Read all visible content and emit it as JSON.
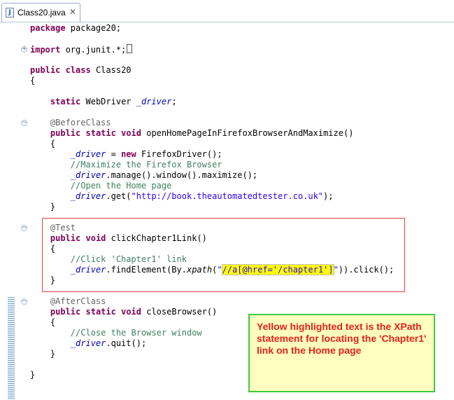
{
  "tab": {
    "title": "Class20.java",
    "close_glyph": "✕",
    "icon": "java-file-icon"
  },
  "code": {
    "package_kw": "package",
    "package_name": " package20;",
    "import_kw": "import",
    "import_rest": " org.junit.*;",
    "class_kw1": "public",
    "class_kw2": "class",
    "class_name": " Class20",
    "brace_open": "{",
    "brace_close": "}",
    "static_kw": "static",
    "webdriver_type": " WebDriver ",
    "driver_field": "_driver",
    "semicolon": ";",
    "before_class": "@BeforeClass",
    "public_kw": "public",
    "static_kw2": "static",
    "void_kw": "void",
    "open_method": " openHomePageInFirefoxBrowserAndMaximize()",
    "new_kw": "new",
    "assign_firefox": " = ",
    "firefox_ctor": " FirefoxDriver();",
    "cmt_maximize": "//Maximize the Firefox Browser",
    "manage_call": ".manage().window().maximize();",
    "cmt_open": "//Open the Home page",
    "get_call_pre": ".get(",
    "get_url": "\"http://book.theautomatedtester.co.uk\"",
    "get_call_post": ");",
    "test_ann": "@Test",
    "click_method": " clickChapter1Link()",
    "cmt_click": "//Click 'Chapter1' link",
    "find_pre": ".findElement(By.",
    "xpath_fn": "xpath",
    "paren_open": "(",
    "quote": "\"",
    "xpath_value": "//a[@href='/chapter1']",
    "find_post": ")).click();",
    "after_class": "@AfterClass",
    "close_method": " closeBrowser()",
    "cmt_close": "//Close the Browser window",
    "quit_call": ".quit();"
  },
  "note": {
    "text": "Yellow highlighted text is the XPath statement for locating the 'Chapter1' link on the Home page"
  },
  "colors": {
    "keyword": "#7f0055",
    "field": "#0000c0",
    "comment": "#3f7f5f",
    "string": "#2a00ff",
    "highlight": "#ffff00",
    "note_text": "#e8201a",
    "note_border": "#3ecb3e",
    "box_border": "#e04040"
  }
}
